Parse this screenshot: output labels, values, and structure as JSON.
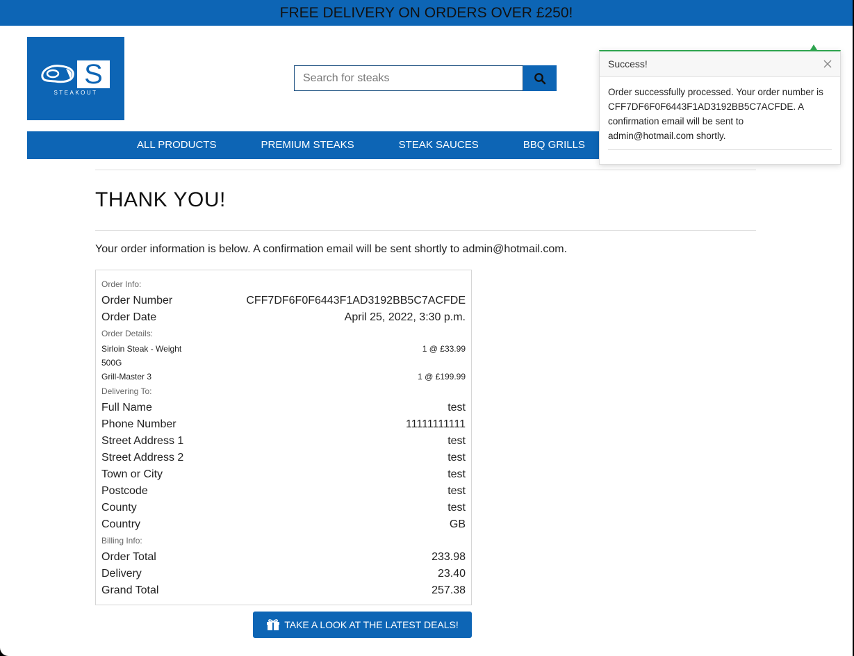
{
  "banner": {
    "text": "FREE DELIVERY ON ORDERS OVER £250!"
  },
  "logo": {
    "letter": "S",
    "wordmark": "STEAKOUT",
    "icon": "steak-icon"
  },
  "search": {
    "placeholder": "Search for steaks",
    "button_icon": "search-icon"
  },
  "nav": {
    "items": [
      {
        "label": "ALL PRODUCTS"
      },
      {
        "label": "PREMIUM STEAKS"
      },
      {
        "label": "STEAK SAUCES"
      },
      {
        "label": "BBQ GRILLS"
      }
    ]
  },
  "toast": {
    "title": "Success!",
    "close_icon": "close-icon",
    "message": "Order successfully processed. Your order number is CFF7DF6F0F6443F1AD3192BB5C7ACFDE. A confirmation email will be sent to admin@hotmail.com shortly."
  },
  "main": {
    "heading": "THANK YOU!",
    "intro": "Your order information is below. A confirmation email will be sent shortly to admin@hotmail.com."
  },
  "order": {
    "order_info": {
      "heading": "Order Info:",
      "rows": [
        {
          "label": "Order Number",
          "value": "CFF7DF6F0F6443F1AD3192BB5C7ACFDE"
        },
        {
          "label": "Order Date",
          "value": "April 25, 2022, 3:30 p.m."
        }
      ]
    },
    "order_details": {
      "heading": "Order Details:",
      "items": [
        {
          "name": "Sirloin Steak - Weight 500G",
          "quantity_price": "1 @ £33.99"
        },
        {
          "name": "Grill-Master 3",
          "quantity_price": "1 @ £199.99"
        }
      ]
    },
    "delivering_to": {
      "heading": "Delivering To:",
      "rows": [
        {
          "label": "Full Name",
          "value": "test"
        },
        {
          "label": "Phone Number",
          "value": "11111111111"
        },
        {
          "label": "Street Address 1",
          "value": "test"
        },
        {
          "label": "Street Address 2",
          "value": "test"
        },
        {
          "label": "Town or City",
          "value": "test"
        },
        {
          "label": "Postcode",
          "value": "test"
        },
        {
          "label": "County",
          "value": "test"
        },
        {
          "label": "Country",
          "value": "GB"
        }
      ]
    },
    "billing_info": {
      "heading": "Billing Info:",
      "rows": [
        {
          "label": "Order Total",
          "value": "233.98"
        },
        {
          "label": "Delivery",
          "value": "23.40"
        },
        {
          "label": "Grand Total",
          "value": "257.38"
        }
      ]
    }
  },
  "cta": {
    "label": "TAKE A LOOK AT THE LATEST DEALS!",
    "icon": "gift-icon"
  },
  "colors": {
    "brand_blue": "#0d65b5",
    "success_green": "#2ea44f",
    "window_frame": "#000000"
  }
}
